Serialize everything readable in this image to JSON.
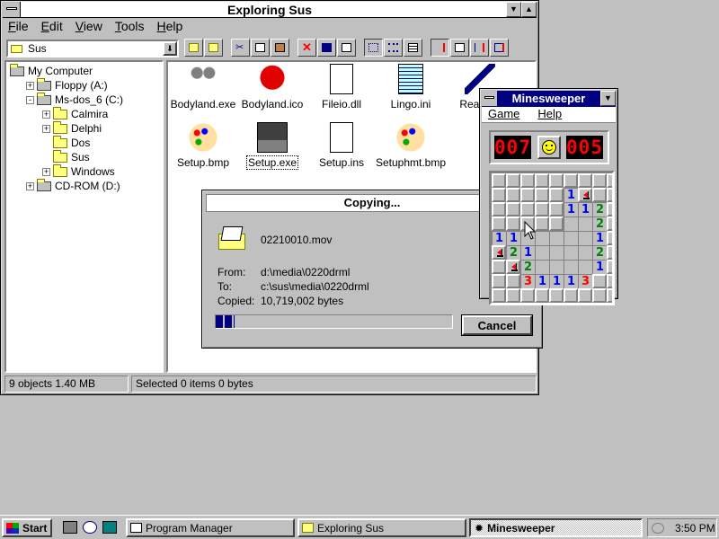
{
  "explorer": {
    "title": "Exploring Sus",
    "menu": [
      "File",
      "Edit",
      "View",
      "Tools",
      "Help"
    ],
    "location": "Sus",
    "tree": [
      {
        "label": "My Computer",
        "indent": 0,
        "exp": ""
      },
      {
        "label": "Floppy (A:)",
        "indent": 1,
        "exp": "+"
      },
      {
        "label": "Ms-dos_6 (C:)",
        "indent": 1,
        "exp": "-"
      },
      {
        "label": "Calmira",
        "indent": 2,
        "exp": "+"
      },
      {
        "label": "Delphi",
        "indent": 2,
        "exp": "+"
      },
      {
        "label": "Dos",
        "indent": 2,
        "exp": ""
      },
      {
        "label": "Sus",
        "indent": 2,
        "exp": ""
      },
      {
        "label": "Windows",
        "indent": 2,
        "exp": "+"
      },
      {
        "label": "CD-ROM (D:)",
        "indent": 1,
        "exp": "+"
      }
    ],
    "files": [
      {
        "name": "Bodyland.exe",
        "icon": "projector-icon"
      },
      {
        "name": "Bodyland.ico",
        "icon": "rooster-icon"
      },
      {
        "name": "Fileio.dll",
        "icon": "dll-file-icon"
      },
      {
        "name": "Lingo.ini",
        "icon": "notepad-icon"
      },
      {
        "name": "Readme",
        "icon": "pen-icon"
      },
      {
        "name": "Setup.bmp",
        "icon": "palette-icon"
      },
      {
        "name": "Setup.exe",
        "icon": "computer-icon"
      },
      {
        "name": "Setup.ins",
        "icon": "dll-file-icon"
      },
      {
        "name": "Setuphmt.bmp",
        "icon": "palette-icon"
      }
    ],
    "status_left": "9 objects  1.40 MB",
    "status_right": "Selected 0 items  0 bytes"
  },
  "copy_dialog": {
    "title": "Copying...",
    "filename": "02210010.mov",
    "from_label": "From:",
    "from_value": "d:\\media\\0220drml",
    "to_label": "To:",
    "to_value": "c:\\sus\\media\\0220drml",
    "copied_label": "Copied:",
    "copied_value": "10,719,002 bytes",
    "progress": 0.08,
    "cancel_label": "Cancel"
  },
  "minesweeper": {
    "title": "Minesweeper",
    "menu": [
      "Game",
      "Help"
    ],
    "mines_left": "007",
    "timer": "005",
    "grid": [
      [
        " ",
        " ",
        " ",
        " ",
        " ",
        " ",
        " ",
        " ",
        " ",
        " "
      ],
      [
        " ",
        " ",
        " ",
        " ",
        " ",
        "1",
        "F",
        " ",
        " ",
        " "
      ],
      [
        " ",
        " ",
        " ",
        " ",
        " ",
        "1",
        "1",
        "2",
        " ",
        " "
      ],
      [
        " ",
        " ",
        " ",
        " ",
        " ",
        " ",
        " ",
        "2",
        " ",
        " "
      ],
      [
        "1",
        "1",
        " ",
        " ",
        " ",
        " ",
        " ",
        "1",
        " ",
        " "
      ],
      [
        "F",
        "2",
        "1",
        " ",
        " ",
        " ",
        " ",
        "2",
        " ",
        " "
      ],
      [
        " ",
        "F",
        "2",
        " ",
        " ",
        " ",
        " ",
        "1",
        " ",
        " "
      ],
      [
        " ",
        " ",
        "3",
        "1",
        "1",
        "1",
        "3",
        " ",
        " ",
        " "
      ],
      [
        " ",
        " ",
        " ",
        " ",
        " ",
        " ",
        " ",
        " ",
        " ",
        " "
      ]
    ],
    "revealed": [
      [
        0,
        0,
        0,
        0,
        0,
        0,
        0,
        0,
        0,
        0
      ],
      [
        0,
        0,
        0,
        0,
        0,
        1,
        0,
        0,
        0,
        0
      ],
      [
        0,
        0,
        0,
        0,
        0,
        1,
        1,
        1,
        0,
        0
      ],
      [
        0,
        0,
        0,
        0,
        0,
        1,
        1,
        1,
        0,
        0
      ],
      [
        1,
        1,
        1,
        1,
        1,
        1,
        1,
        1,
        0,
        0
      ],
      [
        0,
        1,
        1,
        1,
        1,
        1,
        1,
        1,
        0,
        0
      ],
      [
        0,
        0,
        1,
        1,
        1,
        1,
        1,
        1,
        0,
        0
      ],
      [
        0,
        0,
        1,
        1,
        1,
        1,
        1,
        0,
        0,
        0
      ],
      [
        0,
        0,
        0,
        0,
        0,
        0,
        0,
        0,
        0,
        0
      ]
    ]
  },
  "taskbar": {
    "start_label": "Start",
    "tasks": [
      "Program Manager",
      "Exploring Sus",
      "Minesweeper"
    ],
    "clock": "3:50 PM"
  },
  "colors": {
    "title_active": "#000080",
    "lcd": "#ff0000",
    "progress": "#000080"
  }
}
